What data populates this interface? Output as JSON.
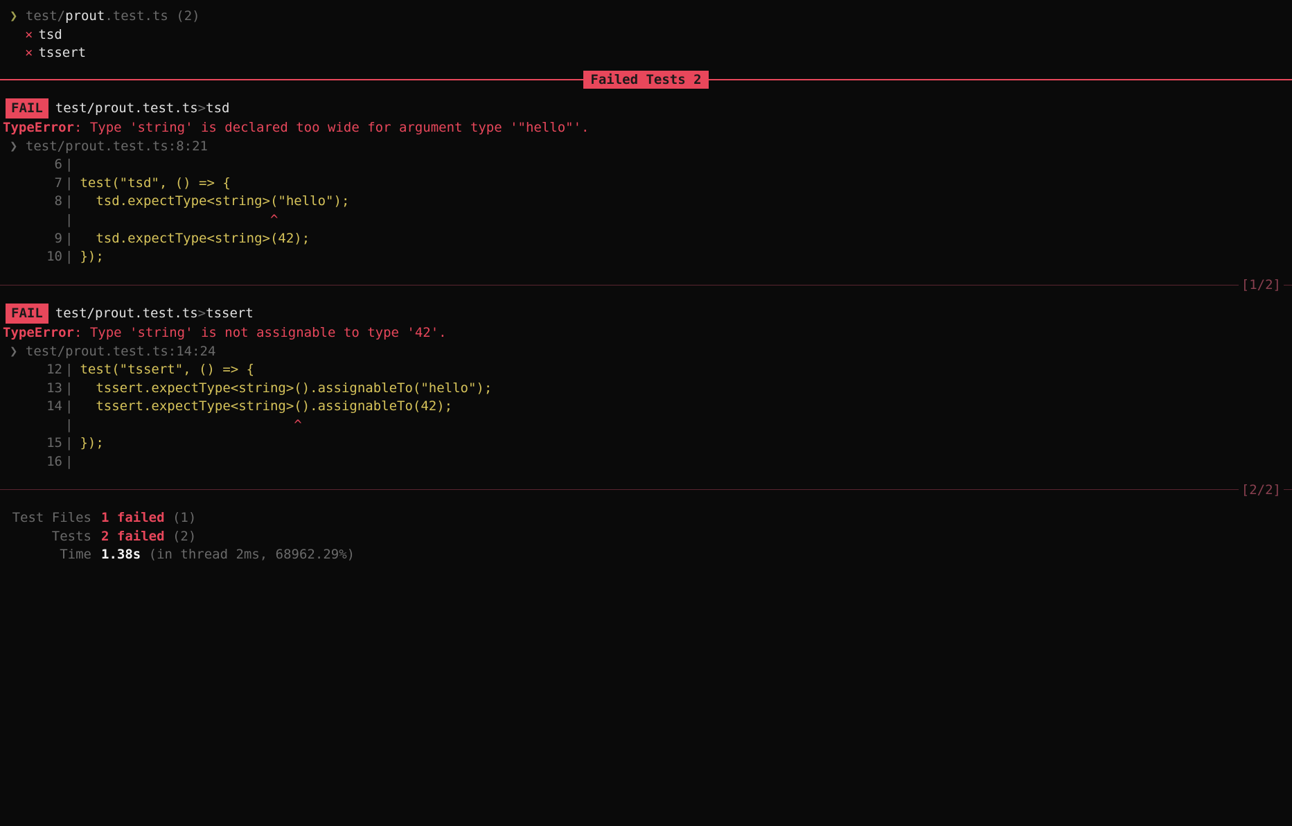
{
  "header": {
    "chevron": "❯",
    "file_prefix": "test/",
    "file_bold": "prout",
    "file_suffix": ".test.ts",
    "count": "(2)"
  },
  "failedList": [
    {
      "x": "×",
      "name": "tsd"
    },
    {
      "x": "×",
      "name": "tssert"
    }
  ],
  "sectionLabel": "Failed Tests 2",
  "failures": [
    {
      "badge": "FAIL",
      "path": "test/prout.test.ts",
      "sep": ">",
      "test": "tsd",
      "errType": "TypeError",
      "errMsg": ": Type 'string' is declared too wide for argument type '\"hello\"'.",
      "locChevron": "❯",
      "loc": "test/prout.test.ts:8:21",
      "code": [
        {
          "n": "6",
          "text": ""
        },
        {
          "n": "7",
          "text": "test(\"tsd\", () => {"
        },
        {
          "n": "8",
          "text": "  tsd.expectType<string>(\"hello\");"
        },
        {
          "n": "",
          "text": "                        ^",
          "caret": true
        },
        {
          "n": "9",
          "text": "  tsd.expectType<string>(42);"
        },
        {
          "n": "10",
          "text": "});"
        }
      ],
      "counter": "[1/2]"
    },
    {
      "badge": "FAIL",
      "path": "test/prout.test.ts",
      "sep": ">",
      "test": "tssert",
      "errType": "TypeError",
      "errMsg": ": Type 'string' is not assignable to type '42'.",
      "locChevron": "❯",
      "loc": "test/prout.test.ts:14:24",
      "code": [
        {
          "n": "12",
          "text": "test(\"tssert\", () => {"
        },
        {
          "n": "13",
          "text": "  tssert.expectType<string>().assignableTo(\"hello\");"
        },
        {
          "n": "14",
          "text": "  tssert.expectType<string>().assignableTo(42);"
        },
        {
          "n": "",
          "text": "                           ^",
          "caret": true
        },
        {
          "n": "15",
          "text": "});"
        },
        {
          "n": "16",
          "text": ""
        }
      ],
      "counter": "[2/2]"
    }
  ],
  "summary": {
    "testFiles": {
      "label": "Test Files",
      "val": "1 failed",
      "suffix": "(1)"
    },
    "tests": {
      "label": "Tests",
      "val": "2 failed",
      "suffix": "(2)"
    },
    "time": {
      "label": "Time",
      "val": "1.38s",
      "suffix": "(in thread 2ms, 68962.29%)"
    }
  }
}
